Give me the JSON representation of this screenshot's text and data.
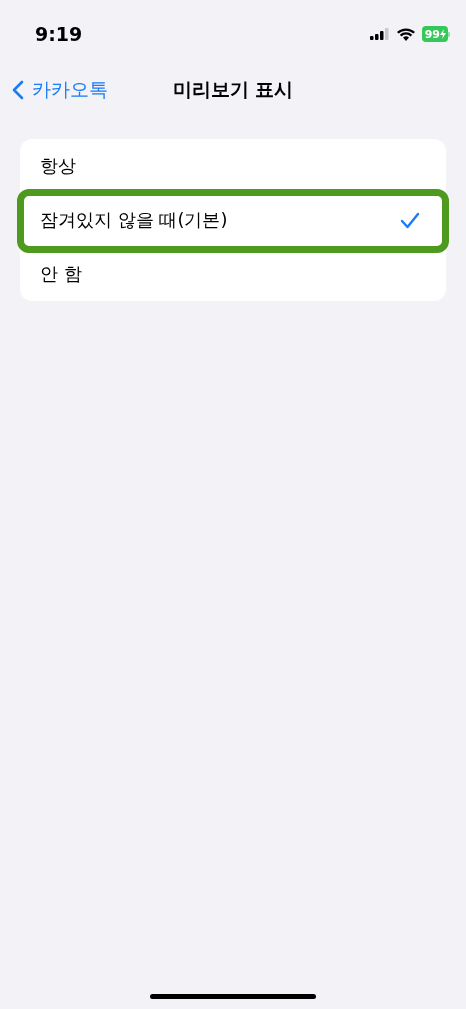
{
  "status_bar": {
    "time": "9:19",
    "battery": "99"
  },
  "nav": {
    "back": "카카오톡",
    "title": "미리보기 표시"
  },
  "options": [
    {
      "label": "항상",
      "selected": false,
      "highlighted": false
    },
    {
      "label": "잠겨있지 않을 때(기본)",
      "selected": true,
      "highlighted": true
    },
    {
      "label": "안 함",
      "selected": false,
      "highlighted": false
    }
  ]
}
